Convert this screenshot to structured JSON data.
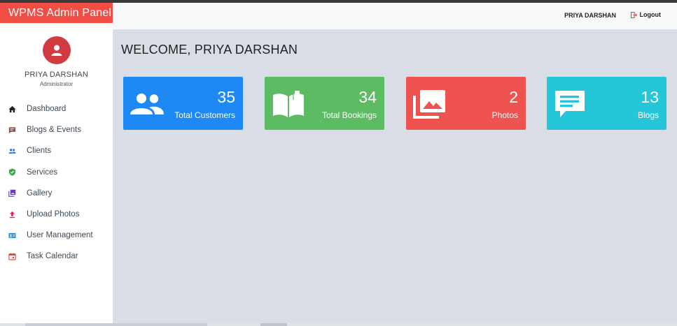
{
  "app": {
    "brand": "WPMS Admin Panel"
  },
  "header": {
    "user_name": "PRIYA DARSHAN",
    "logout_label": "Logout",
    "logout_icon": "logout-icon"
  },
  "sidebar": {
    "profile": {
      "name": "PRIYA DARSHAN",
      "role": "Administrator",
      "avatar_icon": "user-icon",
      "avatar_color": "#d23a41"
    },
    "items": [
      {
        "label": "Dashboard",
        "icon": "home-icon",
        "color": "#222222"
      },
      {
        "label": "Blogs & Events",
        "icon": "comment-icon",
        "color": "#8d4a3c"
      },
      {
        "label": "Clients",
        "icon": "people-icon",
        "color": "#2a7fd4"
      },
      {
        "label": "Services",
        "icon": "shield-check-icon",
        "color": "#3aa84a"
      },
      {
        "label": "Gallery",
        "icon": "gallery-icon",
        "color": "#6a3fb5"
      },
      {
        "label": "Upload Photos",
        "icon": "upload-icon",
        "color": "#d8285a"
      },
      {
        "label": "User Management",
        "icon": "id-card-icon",
        "color": "#2a8fd4"
      },
      {
        "label": "Task Calendar",
        "icon": "calendar-icon",
        "color": "#e0443b"
      }
    ]
  },
  "main": {
    "welcome": "WELCOME, PRIYA DARSHAN",
    "cards": [
      {
        "value": "35",
        "caption": "Total Customers",
        "icon": "people-icon",
        "color": "#1e88f5"
      },
      {
        "value": "34",
        "caption": "Total Bookings",
        "icon": "book-icon",
        "color": "#5dbb63"
      },
      {
        "value": "2",
        "caption": "Photos",
        "icon": "photo-library-icon",
        "color": "#ef5350"
      },
      {
        "value": "13",
        "caption": "Blogs",
        "icon": "message-icon",
        "color": "#26c6da"
      }
    ]
  }
}
